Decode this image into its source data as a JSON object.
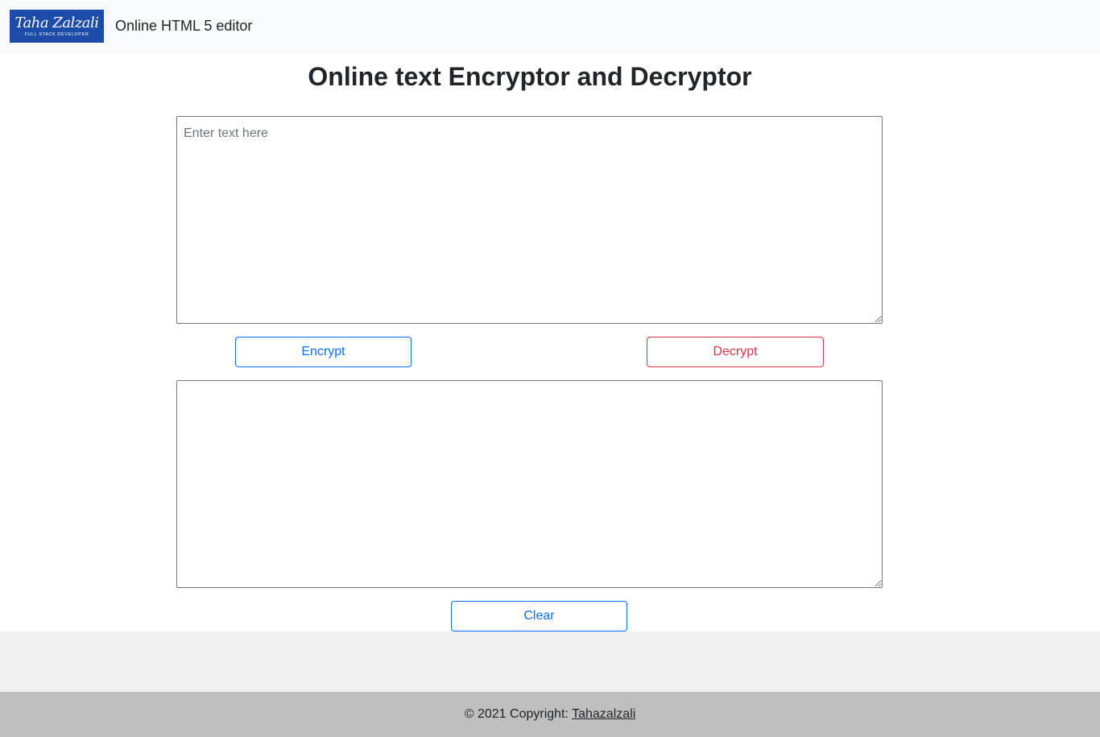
{
  "navbar": {
    "logo": {
      "name": "Taha Zalzali",
      "tagline": "FULL STACK DEVELOPER"
    },
    "brand_text": "Online HTML 5 editor"
  },
  "page": {
    "title": "Online text Encryptor and Decryptor"
  },
  "input": {
    "placeholder": "Enter text here",
    "value": ""
  },
  "output": {
    "value": ""
  },
  "buttons": {
    "encrypt": "Encrypt",
    "decrypt": "Decrypt",
    "clear": "Clear"
  },
  "footer": {
    "text": "© 2021 Copyright: ",
    "link": "Tahazalzali"
  },
  "colors": {
    "primary": "#0d6efd",
    "danger": "#dc3545",
    "navbar_bg": "#f8f9fa",
    "logo_bg": "#1c4ba8",
    "footer_bg": "#bfbfbf",
    "band_bg": "#f0f0f0"
  }
}
